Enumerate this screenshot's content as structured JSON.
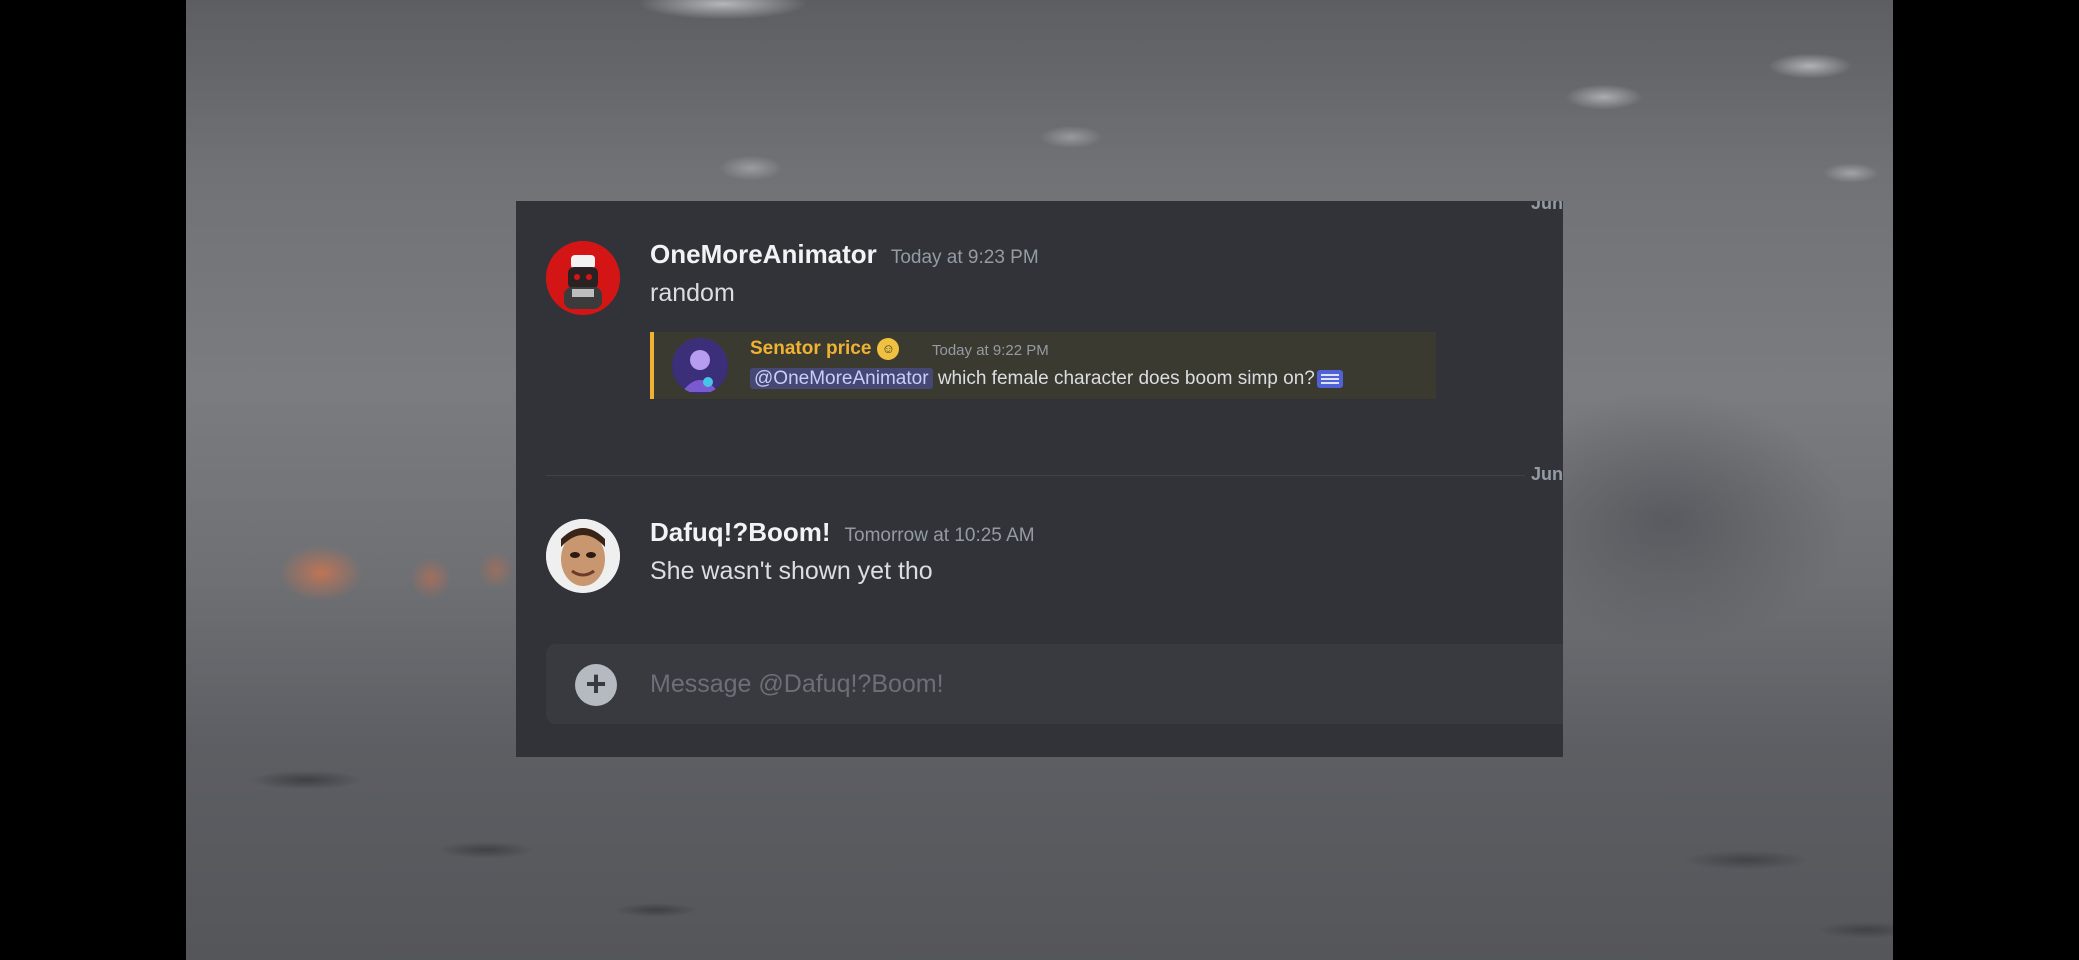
{
  "messages": [
    {
      "username": "OneMoreAnimator",
      "timestamp": "Today at 9:23 PM",
      "content": "random",
      "avatar_icon": "red-helmet-avatar",
      "reply": {
        "username": "Senator price",
        "timestamp": "Today at 9:22 PM",
        "mention": "@OneMoreAnimator",
        "text": "which female character does boom simp on?",
        "emoji_icon": "emoji-badge-icon",
        "trailing_icon": "emoji-icon"
      }
    },
    {
      "username": "Dafuq!?Boom!",
      "timestamp": "Tomorrow at 10:25 AM",
      "content": "She wasn't shown yet tho",
      "avatar_icon": "face-avatar"
    }
  ],
  "dividers": {
    "top_edge": "Jun",
    "date": "Jun"
  },
  "composer": {
    "placeholder": "Message @Dafuq!?Boom!",
    "plus": "+"
  },
  "colors": {
    "panel_bg": "#313338",
    "username": "#f2f3f5",
    "reply_accent": "#f0b232",
    "mention": "#5865f2"
  }
}
